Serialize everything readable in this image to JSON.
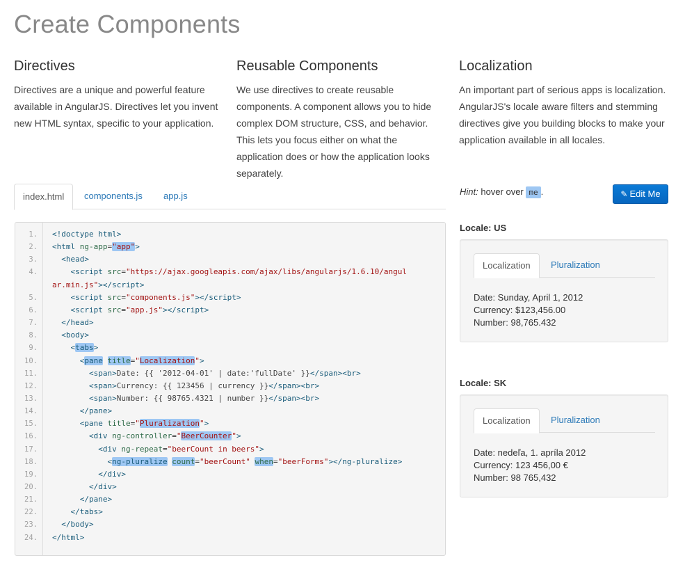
{
  "title": "Create Components",
  "columns": [
    {
      "heading": "Directives",
      "text": "Directives are a unique and powerful feature available in AngularJS. Directives let you invent new HTML syntax, specific to your application."
    },
    {
      "heading": "Reusable Components",
      "text": "We use directives to create reusable components. A component allows you to hide complex DOM structure, CSS, and behavior. This lets you focus either on what the application does or how the application looks separately."
    },
    {
      "heading": "Localization",
      "text": "An important part of serious apps is localization. AngularJS's locale aware filters and stemming directives give you building blocks to make your application available in all locales."
    }
  ],
  "file_tabs": [
    "index.html",
    "components.js",
    "app.js"
  ],
  "active_file_tab": "index.html",
  "code_lines": [
    {
      "n": "1.",
      "html": "<span class='tg'>&lt;!doctype html&gt;</span>"
    },
    {
      "n": "2.",
      "html": "<span class='tg'>&lt;html</span> <span class='at'>ng-app</span>=<span class='st hl'>\"app\"</span><span class='tg'>&gt;</span>"
    },
    {
      "n": "3.",
      "html": "  <span class='tg'>&lt;head&gt;</span>"
    },
    {
      "n": "4.",
      "html": "    <span class='tg'>&lt;script</span> <span class='at'>src</span>=<span class='st'>\"https://ajax.googleapis.com/ajax/libs/angularjs/1.6.10/angul</span>"
    },
    {
      "n": "",
      "html": "<span class='st'>ar.min.js\"</span><span class='tg'>&gt;&lt;/script&gt;</span>"
    },
    {
      "n": "5.",
      "html": "    <span class='tg'>&lt;script</span> <span class='at'>src</span>=<span class='st'>\"components.js\"</span><span class='tg'>&gt;&lt;/script&gt;</span>"
    },
    {
      "n": "6.",
      "html": "    <span class='tg'>&lt;script</span> <span class='at'>src</span>=<span class='st'>\"app.js\"</span><span class='tg'>&gt;&lt;/script&gt;</span>"
    },
    {
      "n": "7.",
      "html": "  <span class='tg'>&lt;/head&gt;</span>"
    },
    {
      "n": "8.",
      "html": "  <span class='tg'>&lt;body&gt;</span>"
    },
    {
      "n": "9.",
      "html": "    <span class='tg'>&lt;<span class='hl'>tabs</span>&gt;</span>"
    },
    {
      "n": "10.",
      "html": "      <span class='tg'>&lt;<span class='hl'>pane</span></span> <span class='at hl'>title</span>=<span class='st'>\"<span class='hl'>Localization</span>\"</span><span class='tg'>&gt;</span>"
    },
    {
      "n": "11.",
      "html": "        <span class='tg'>&lt;span&gt;</span><span class='tx'>Date: {{ '2012-04-01' | date:'fullDate' }}</span><span class='tg'>&lt;/span&gt;&lt;br&gt;</span>"
    },
    {
      "n": "12.",
      "html": "        <span class='tg'>&lt;span&gt;</span><span class='tx'>Currency: {{ 123456 | currency }}</span><span class='tg'>&lt;/span&gt;&lt;br&gt;</span>"
    },
    {
      "n": "13.",
      "html": "        <span class='tg'>&lt;span&gt;</span><span class='tx'>Number: {{ 98765.4321 | number }}</span><span class='tg'>&lt;/span&gt;&lt;br&gt;</span>"
    },
    {
      "n": "14.",
      "html": "      <span class='tg'>&lt;/pane&gt;</span>"
    },
    {
      "n": "15.",
      "html": "      <span class='tg'>&lt;pane</span> <span class='at'>title</span>=<span class='st'>\"<span class='hl'>Pluralization</span>\"</span><span class='tg'>&gt;</span>"
    },
    {
      "n": "16.",
      "html": "        <span class='tg'>&lt;div</span> <span class='at'>ng-controller</span>=<span class='st'>\"<span class='hl'>BeerCounter</span>\"</span><span class='tg'>&gt;</span>"
    },
    {
      "n": "17.",
      "html": "          <span class='tg'>&lt;div</span> <span class='at'>ng-repeat</span>=<span class='st'>\"beerCount in beers\"</span><span class='tg'>&gt;</span>"
    },
    {
      "n": "18.",
      "html": "            <span class='tg'>&lt;<span class='hl'>ng-pluralize</span></span> <span class='at hl'>count</span>=<span class='st'>\"beerCount\"</span> <span class='at hl'>when</span>=<span class='st'>\"beerForms\"</span><span class='tg'>&gt;&lt;/ng-pluralize&gt;</span>"
    },
    {
      "n": "19.",
      "html": "          <span class='tg'>&lt;/div&gt;</span>"
    },
    {
      "n": "20.",
      "html": "        <span class='tg'>&lt;/div&gt;</span>"
    },
    {
      "n": "21.",
      "html": "      <span class='tg'>&lt;/pane&gt;</span>"
    },
    {
      "n": "22.",
      "html": "    <span class='tg'>&lt;/tabs&gt;</span>"
    },
    {
      "n": "23.",
      "html": "  <span class='tg'>&lt;/body&gt;</span>"
    },
    {
      "n": "24.",
      "html": "<span class='tg'>&lt;/html&gt;</span>"
    }
  ],
  "hint": {
    "label": "Hint:",
    "text": " hover over ",
    "code": "me",
    "end": "."
  },
  "edit_button": {
    "icon": "pencil-icon",
    "label": "Edit Me",
    "color": "#0a7ad6"
  },
  "locales": [
    {
      "label": "Locale: US",
      "tabs": [
        "Localization",
        "Pluralization"
      ],
      "active_tab": "Localization",
      "lines": [
        "Date: Sunday, April 1, 2012",
        "Currency: $123,456.00",
        "Number: 98,765.432"
      ]
    },
    {
      "label": "Locale: SK",
      "tabs": [
        "Localization",
        "Pluralization"
      ],
      "active_tab": "Localization",
      "lines": [
        "Date: nedeľa, 1. apríla 2012",
        "Currency: 123 456,00 €",
        "Number: 98 765,432"
      ]
    }
  ],
  "colors": {
    "link": "#2d7ab8",
    "highlight": "#9ec7f3",
    "button": "#0a7ad6"
  }
}
